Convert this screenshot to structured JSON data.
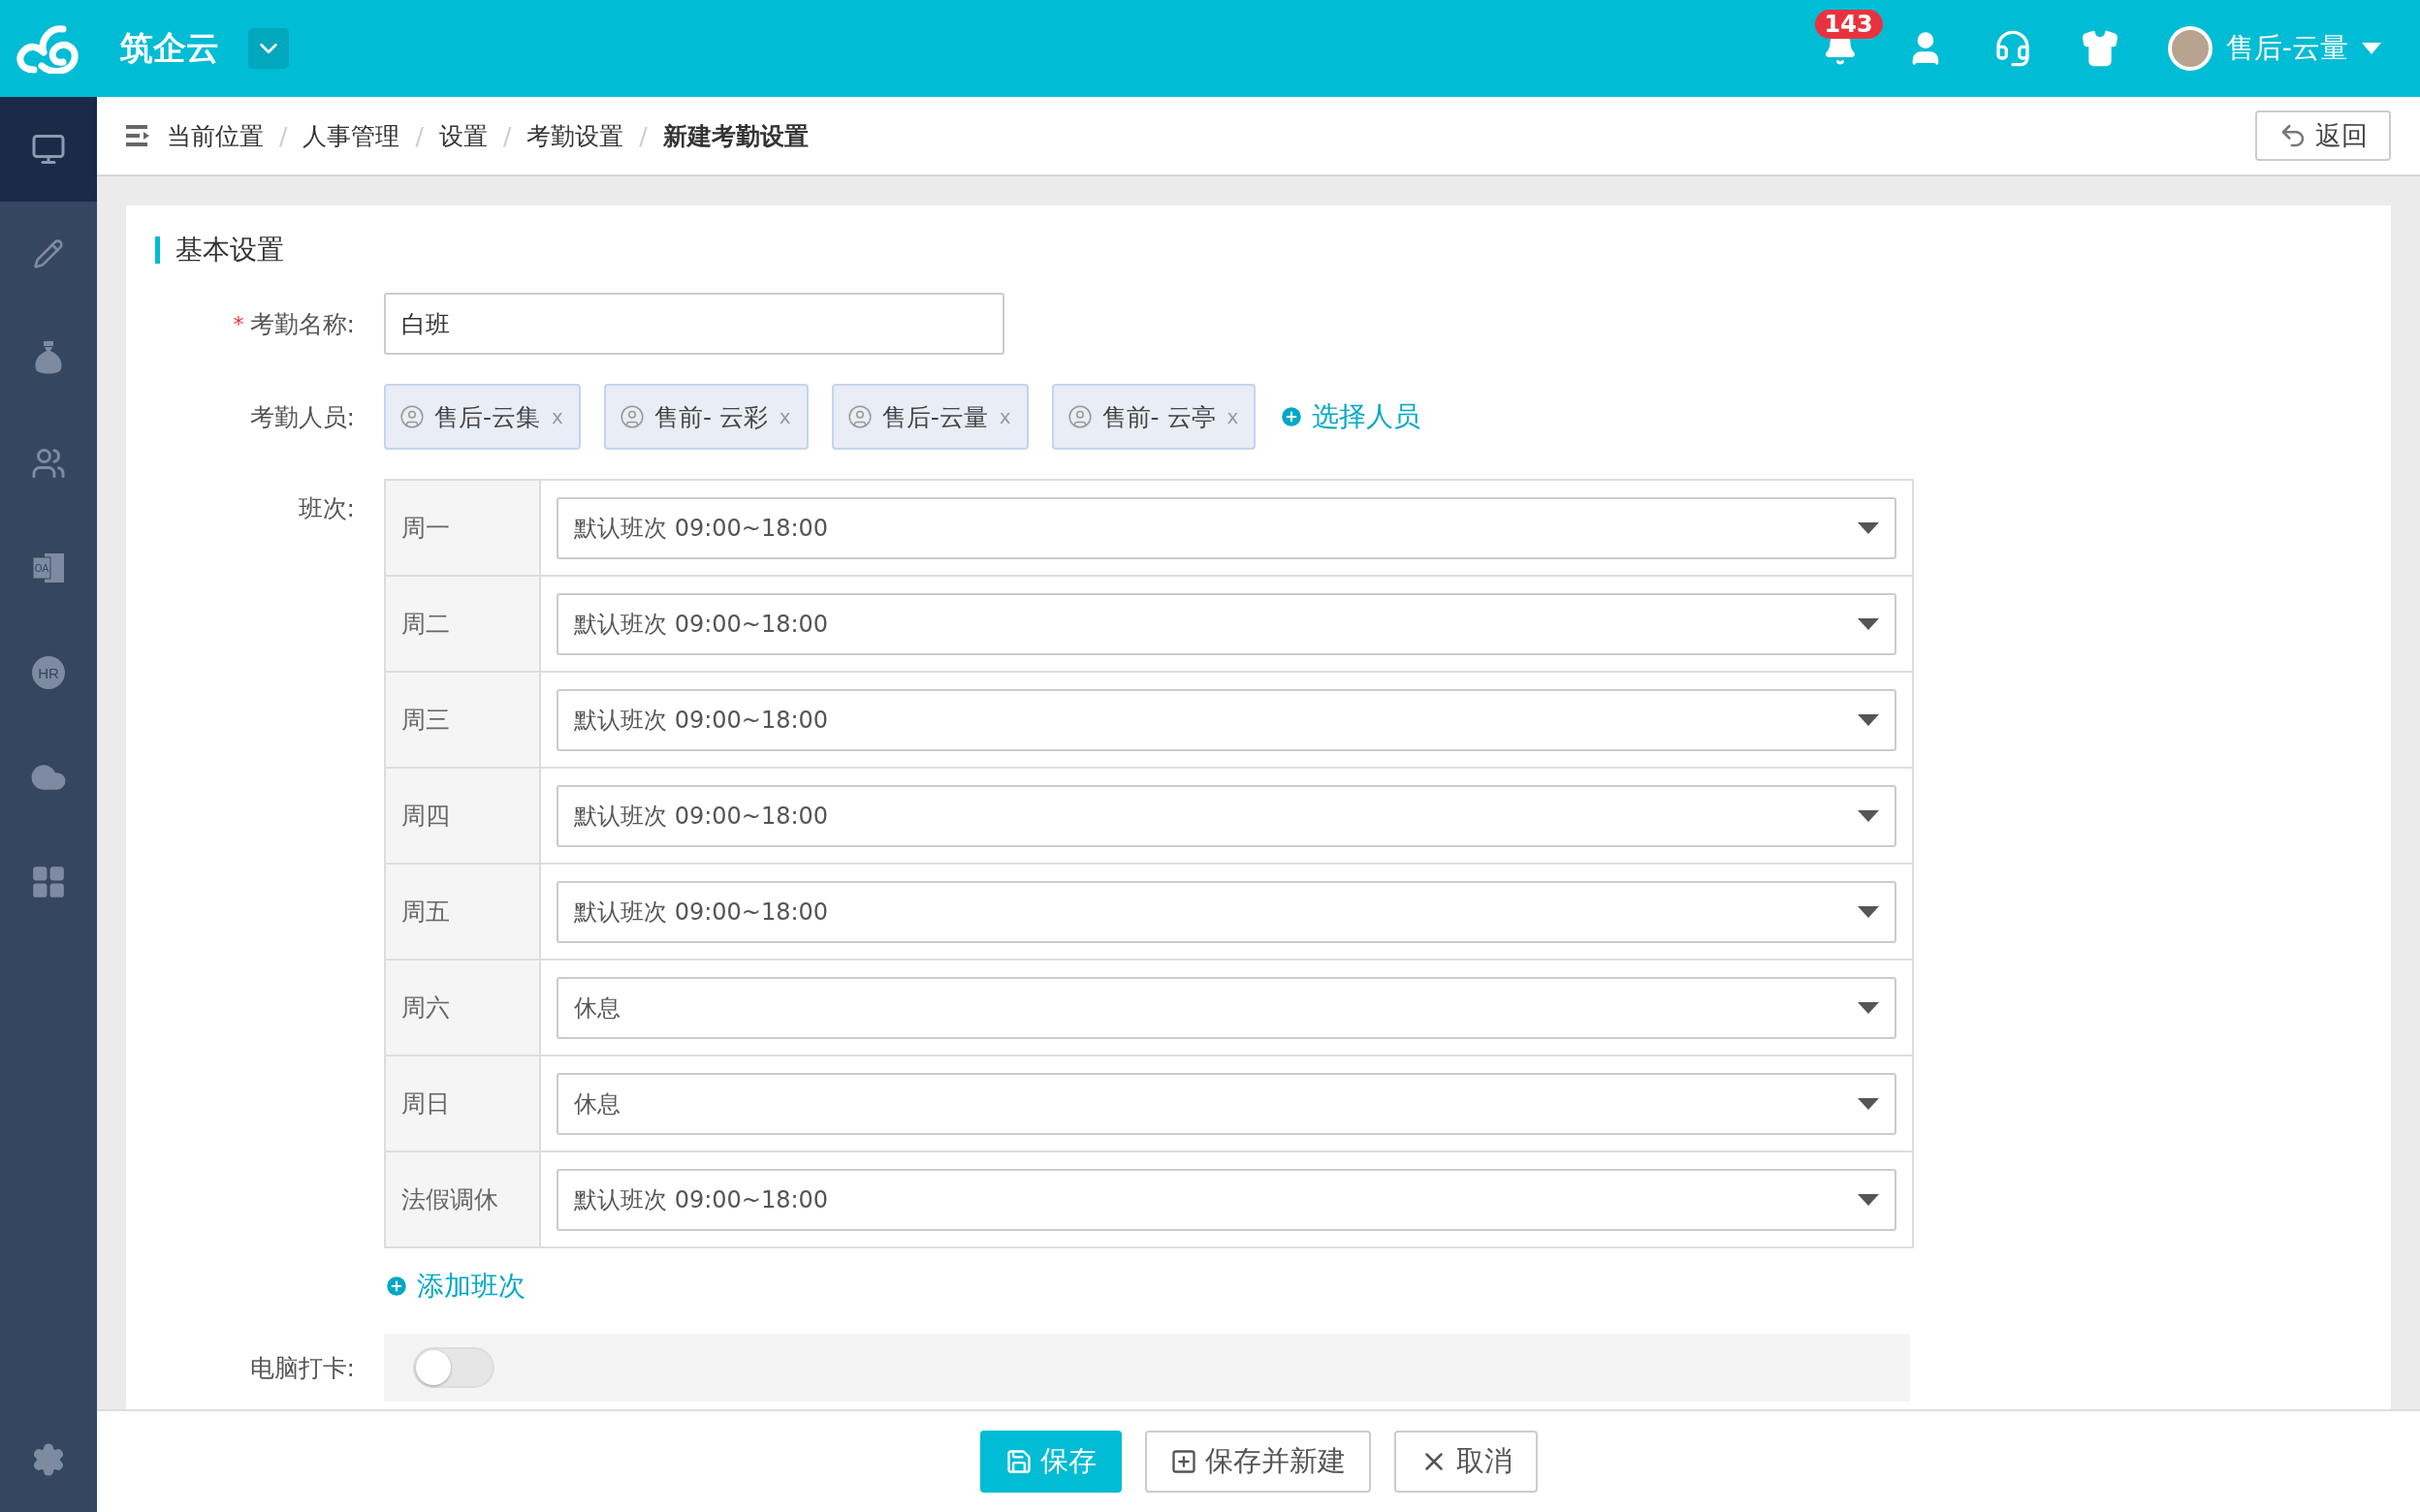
{
  "header": {
    "logo_title": "筑企云",
    "notification_count": "143",
    "user_name": "售后-云量"
  },
  "sidebar": {
    "items": [
      {
        "kind": "monitor",
        "selected": true
      },
      {
        "kind": "pencil",
        "selected": false
      },
      {
        "kind": "money",
        "selected": false
      },
      {
        "kind": "users",
        "selected": false
      },
      {
        "kind": "oa",
        "label": "OA",
        "selected": false
      },
      {
        "kind": "hr",
        "label": "HR",
        "selected": false
      },
      {
        "kind": "cloud",
        "selected": false
      },
      {
        "kind": "grid",
        "selected": false
      }
    ]
  },
  "breadcrumb": {
    "label": "当前位置",
    "items": [
      "人事管理",
      "设置",
      "考勤设置",
      "新建考勤设置"
    ],
    "separator": "/",
    "back_button": "返回"
  },
  "form": {
    "section_title": "基本设置",
    "name": {
      "label": "考勤名称:",
      "required_mark": "*",
      "value": "白班"
    },
    "attendees": {
      "label": "考勤人员:",
      "people": [
        {
          "name": "售后-云集",
          "remove": "x"
        },
        {
          "name": "售前- 云彩",
          "remove": "x"
        },
        {
          "name": "售后-云量",
          "remove": "x"
        },
        {
          "name": "售前- 云亭",
          "remove": "x"
        }
      ],
      "add_link": "选择人员"
    },
    "shifts": {
      "label": "班次:",
      "rows": [
        {
          "day": "周一",
          "shift": "默认班次 09:00~18:00"
        },
        {
          "day": "周二",
          "shift": "默认班次 09:00~18:00"
        },
        {
          "day": "周三",
          "shift": "默认班次 09:00~18:00"
        },
        {
          "day": "周四",
          "shift": "默认班次 09:00~18:00"
        },
        {
          "day": "周五",
          "shift": "默认班次 09:00~18:00"
        },
        {
          "day": "周六",
          "shift": "休息"
        },
        {
          "day": "周日",
          "shift": "休息"
        },
        {
          "day": "法假调休",
          "shift": "默认班次 09:00~18:00"
        }
      ]
    },
    "add_shift": "添加班次",
    "computer_punch": {
      "label": "电脑打卡:",
      "on": false
    }
  },
  "footer": {
    "buttons": [
      {
        "kind": "save",
        "label": "保存"
      },
      {
        "kind": "save_new",
        "label": "保存并新建"
      },
      {
        "kind": "cancel",
        "label": "取消"
      }
    ]
  }
}
